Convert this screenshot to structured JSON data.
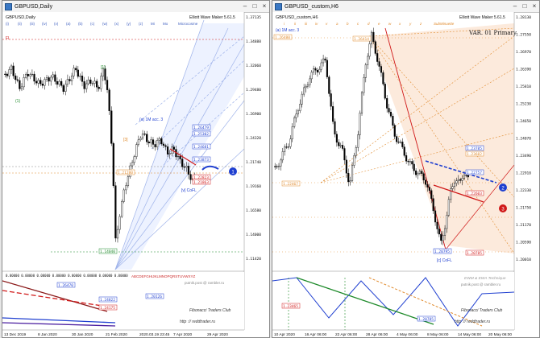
{
  "left": {
    "title": "GBPUSD,Daily",
    "symbol_tf": "GBPUSD,Daily",
    "indicator": "Elliott Wave Maker 5.61.5",
    "wave_row": [
      "(i)",
      "(ii)",
      "(iii)",
      "(iv)",
      "(v)",
      "(a)",
      "(b)",
      "(c)",
      "(w)",
      "(x)",
      "(y)",
      "(z)",
      "Mi",
      "Mo"
    ],
    "wave_row_tail": "Microcosme",
    "flag": "FL",
    "prices": [
      "1.37135",
      "1.34888",
      "1.32060",
      "1.29480",
      "1.26900",
      "1.24320",
      "1.21740",
      "1.19160",
      "1.16580",
      "1.14000",
      "1.11420"
    ],
    "hline_labels": [
      "1.26479",
      "1.25302",
      "1.24681",
      "1.23873",
      "1.22823",
      "1.21863",
      "1.21280"
    ],
    "wave_labels": {
      "top": "[1]",
      "w1": "(1)",
      "w2": "[2]",
      "w3": "[3]",
      "w4": "(4)",
      "w5": "(5)",
      "extra": "(a) 1M acc. 3",
      "bottom": "[v] CoFL",
      "low": "1.14040"
    },
    "circle_marker": "1",
    "osc_values": [
      "0.00000",
      "0.00000",
      "0.00000",
      "0.00000",
      "0.00000",
      "0.00000",
      "0.00000",
      "0.00000"
    ],
    "osc_labels": [
      "1.26470",
      "1.24822",
      "1.24175",
      "1.20126"
    ],
    "watermark_line1": "ABCDEFGHIJKLMNOPQRSTUVWXYZ",
    "watermark_line2": "putnik.post @ rambler.ru",
    "club": "Fibonacci   Traders   Club",
    "site": "http :// reddtrader.ru",
    "dates": [
      "13 Dec 2019",
      "8 Jan 2020",
      "30 Jan 2020",
      "21 Feb 2020",
      "2020.03.19 23:45",
      "7 Apr 2020",
      "29 Apr 2020"
    ]
  },
  "right": {
    "title": "GBPUSD_custom,H6",
    "symbol_tf": "GBPUSD_custom,H6",
    "indicator": "Elliott Wave Maker 5.61.5",
    "wave_row": [
      "i",
      "ii",
      "iii",
      "iv",
      "v",
      "a",
      "b",
      "c",
      "d",
      "e",
      "w",
      "x",
      "y",
      "z"
    ],
    "wave_row_tail": "SubMinuette",
    "header_label": "(a) 1M acc. 3",
    "var": "VAR. 01 Primary",
    "prices": [
      "1.28130",
      "1.27550",
      "1.26970",
      "1.26390",
      "1.25810",
      "1.25230",
      "1.24650",
      "1.24070",
      "1.23490",
      "1.22910",
      "1.22330",
      "1.21750",
      "1.21170",
      "1.20590",
      "1.20010"
    ],
    "level_labels": {
      "top": "1.26480",
      "peak": "1.26414",
      "left": "1.22467",
      "r1": "1.23785",
      "r2": "1.23682",
      "r3": "1.22757",
      "r4": "1.22603",
      "r5": "1.20785",
      "low": "1.20795"
    },
    "bottom_label": "[c] CoFL",
    "circle_blue": "2",
    "circle_red": "3",
    "osc_labels": [
      "1.23465",
      "1.20785"
    ],
    "watermark_line1": "EWM & EWA Technique",
    "watermark_line2": "putnik.post @ rambler.ru",
    "club": "Fibonacci   Traders   Club",
    "site": "http :// reddtrader.ru",
    "dates": [
      "10 Apr 2020",
      "16 Apr 06:00",
      "22 Apr 06:00",
      "28 Apr 06:00",
      "4 May 06:00",
      "8 May 06:00",
      "14 May 06:00",
      "20 May 06:00"
    ]
  },
  "colors": {
    "bull": "#000000",
    "bear": "#000000",
    "blue": "#1f3fd0",
    "red": "#d01818",
    "green": "#1e8a2a",
    "orange": "#e08a2c",
    "fan": "#b8c8f0"
  }
}
